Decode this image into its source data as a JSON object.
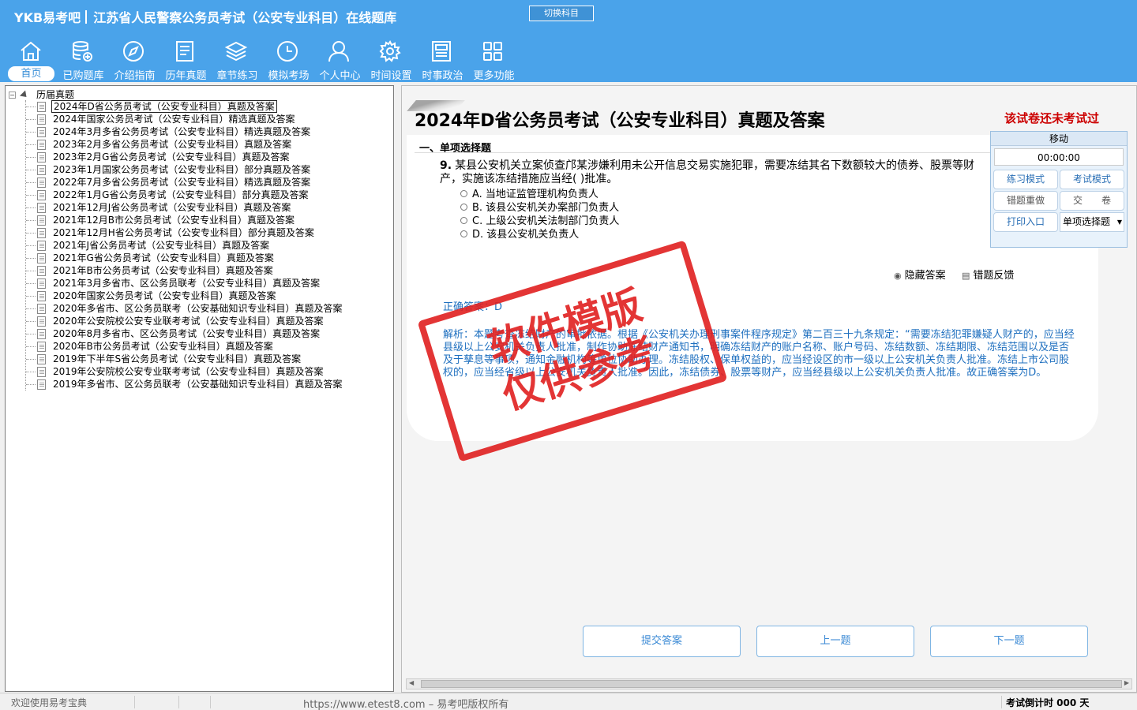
{
  "header": {
    "logo": "YKB易考吧",
    "title": "江苏省人民警察公务员考试（公安专业科目）在线题库",
    "switch_subject": "切换科目"
  },
  "nav": [
    {
      "label": "首页",
      "icon": "home-icon"
    },
    {
      "label": "已购题库",
      "icon": "database-icon"
    },
    {
      "label": "介绍指南",
      "icon": "compass-icon"
    },
    {
      "label": "历年真题",
      "icon": "document-list-icon"
    },
    {
      "label": "章节练习",
      "icon": "layers-icon"
    },
    {
      "label": "模拟考场",
      "icon": "clock-icon"
    },
    {
      "label": "个人中心",
      "icon": "user-icon"
    },
    {
      "label": "时间设置",
      "icon": "gear-icon"
    },
    {
      "label": "时事政治",
      "icon": "newspaper-icon"
    },
    {
      "label": "更多功能",
      "icon": "grid-icon"
    }
  ],
  "tree": {
    "root": "历届真题",
    "items": [
      "2024年D省公务员考试（公安专业科目）真题及答案",
      "2024年国家公务员考试（公安专业科目）精选真题及答案",
      "2024年3月多省公务员考试（公安专业科目）精选真题及答案",
      "2023年2月多省公务员考试（公安专业科目）真题及答案",
      "2023年2月G省公务员考试（公安专业科目）真题及答案",
      "2023年1月国家公务员考试（公安专业科目）部分真题及答案",
      "2022年7月多省公务员考试（公安专业科目）精选真题及答案",
      "2022年1月G省公务员考试（公安专业科目）部分真题及答案",
      "2021年12月J省公务员考试（公安专业科目）真题及答案",
      "2021年12月B市公务员考试（公安专业科目）真题及答案",
      "2021年12月H省公务员考试（公安专业科目）部分真题及答案",
      "2021年J省公务员考试（公安专业科目）真题及答案",
      "2021年G省公务员考试（公安专业科目）真题及答案",
      "2021年B市公务员考试（公安专业科目）真题及答案",
      "2021年3月多省市、区公务员联考（公安专业科目）真题及答案",
      "2020年国家公务员考试（公安专业科目）真题及答案",
      "2020年多省市、区公务员联考（公安基础知识专业科目）真题及答案",
      "2020年公安院校公安专业联考考试（公安专业科目）真题及答案",
      "2020年8月多省市、区公务员考试（公安专业科目）真题及答案",
      "2020年B市公务员考试（公安专业科目）真题及答案",
      "2019年下半年S省公务员考试（公安专业科目）真题及答案",
      "2019年公安院校公安专业联考考试（公安专业科目）真题及答案",
      "2019年多省市、区公务员联考（公安基础知识专业科目）真题及答案"
    ]
  },
  "exam": {
    "title": "2024年D省公务员考试（公安专业科目）真题及答案",
    "status": "该试卷还未考试过",
    "section": "一、单项选择题",
    "question_number": "9.",
    "question_text": "某县公安机关立案侦查邝某涉嫌利用未公开信息交易实施犯罪，需要冻结其名下数额较大的债券、股票等财产，实施该冻结措施应当经(  )批准。",
    "options": [
      "A. 当地证监管理机构负责人",
      "B. 该县公安机关办案部门负责人",
      "C. 上级公安机关法制部门负责人",
      "D. 该县公安机关负责人"
    ],
    "hide_answer": "隐藏答案",
    "error_feedback": "错题反馈",
    "correct_answer": "正确答案：D",
    "analysis": "解析：本题考查冻结财产的审批依据。根据《公安机关办理刑事案件程序规定》第二百三十九条规定：“需要冻结犯罪嫌疑人财产的，应当经县级以上公安机关负责人批准，制作协助冻结财产通知书，明确冻结财产的账户名称、账户号码、冻结数额、冻结期限、冻结范围以及是否及于孳息等事项，通知金融机构等单位协助办理。冻结股权、保单权益的，应当经设区的市一级以上公安机关负责人批准。冻结上市公司股权的，应当经省级以上公安机关负责人批准。”因此，冻结债券、股票等财产，应当经县级以上公安机关负责人批准。故正确答案为D。"
  },
  "tool_panel": {
    "move": "移动",
    "timer": "00:00:00",
    "practice_mode": "练习模式",
    "exam_mode": "考试模式",
    "redo_wrong": "错题重做",
    "submit_paper": "交　　卷",
    "print_entry": "打印入口",
    "question_type": "单项选择题"
  },
  "buttons": {
    "submit": "提交答案",
    "prev": "上一题",
    "next": "下一题"
  },
  "statusbar": {
    "welcome": "欢迎使用易考宝典",
    "copyright": "https://www.etest8.com – 易考吧版权所有",
    "countdown": "考试倒计时 000 天"
  },
  "watermark": {
    "line1": "软件模版",
    "line2": "仅供参考"
  },
  "colors": {
    "header_bg": "#4aa3ea",
    "accent_blue": "#1e6fbf",
    "status_red": "#cc0000",
    "stamp_red": "#e02020"
  }
}
